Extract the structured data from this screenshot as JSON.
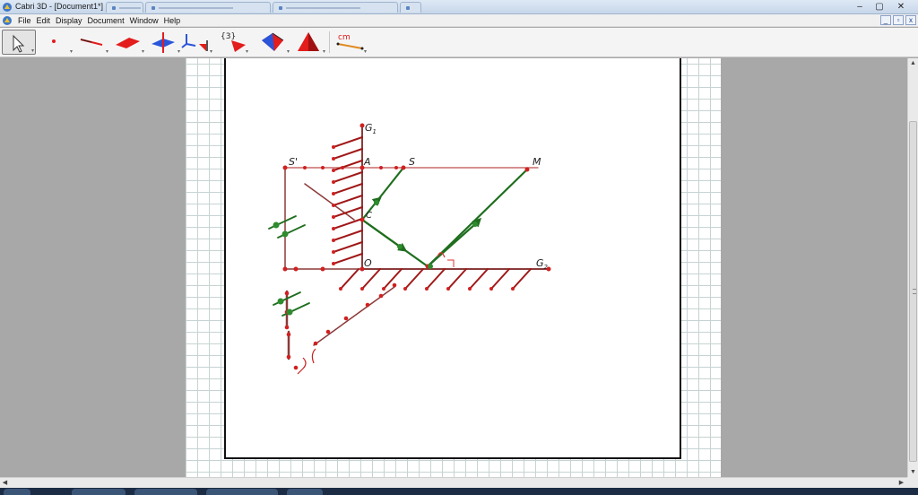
{
  "window": {
    "title": "Cabri 3D - [Document1*]",
    "controls": {
      "minimize": "–",
      "maximize": "▢",
      "close": "✕"
    },
    "mdi_controls": {
      "minimize": "_",
      "restore": "▫",
      "close": "x"
    }
  },
  "menu": {
    "items": [
      "File",
      "Edit",
      "Display",
      "Document",
      "Window",
      "Help"
    ]
  },
  "toolbar": {
    "tools": [
      {
        "name": "pointer-tool",
        "icon": "arrow-pointer-icon",
        "selected": true
      },
      {
        "name": "point-tool",
        "icon": "point-icon"
      },
      {
        "name": "line-tool",
        "icon": "line-icon"
      },
      {
        "name": "plane-tool",
        "icon": "plane-icon"
      },
      {
        "name": "perpendicular-tool",
        "icon": "perpendicular-icon"
      },
      {
        "name": "axes-tool",
        "icon": "axes-icon"
      },
      {
        "name": "transformation-tool",
        "icon": "transformation-icon",
        "label": "{3}"
      },
      {
        "name": "polyhedron-tool",
        "icon": "polyhedron-icon"
      },
      {
        "name": "pyramid-tool",
        "icon": "pyramid-icon"
      },
      {
        "name": "measurement-tool",
        "icon": "measure-icon",
        "label": "cm"
      }
    ],
    "colors": {
      "red": "#e31c1c",
      "blue": "#2a55d9",
      "dark": "#222222"
    }
  },
  "figure": {
    "labels": {
      "g1": "G",
      "g1_sub": "1",
      "g2": "G",
      "g2_sub": "2",
      "s_prime": "S'",
      "a": "A",
      "s": "S",
      "m": "M",
      "o": "O",
      "c": "C"
    },
    "colors": {
      "line_dark": "#8b3a3a",
      "line_light": "#c86a6a",
      "point": "#d02020",
      "hatch": "#a01818",
      "ray": "#1e6e1e",
      "ray_point": "#2e8b2e",
      "angle_mark": "#e03030"
    }
  }
}
